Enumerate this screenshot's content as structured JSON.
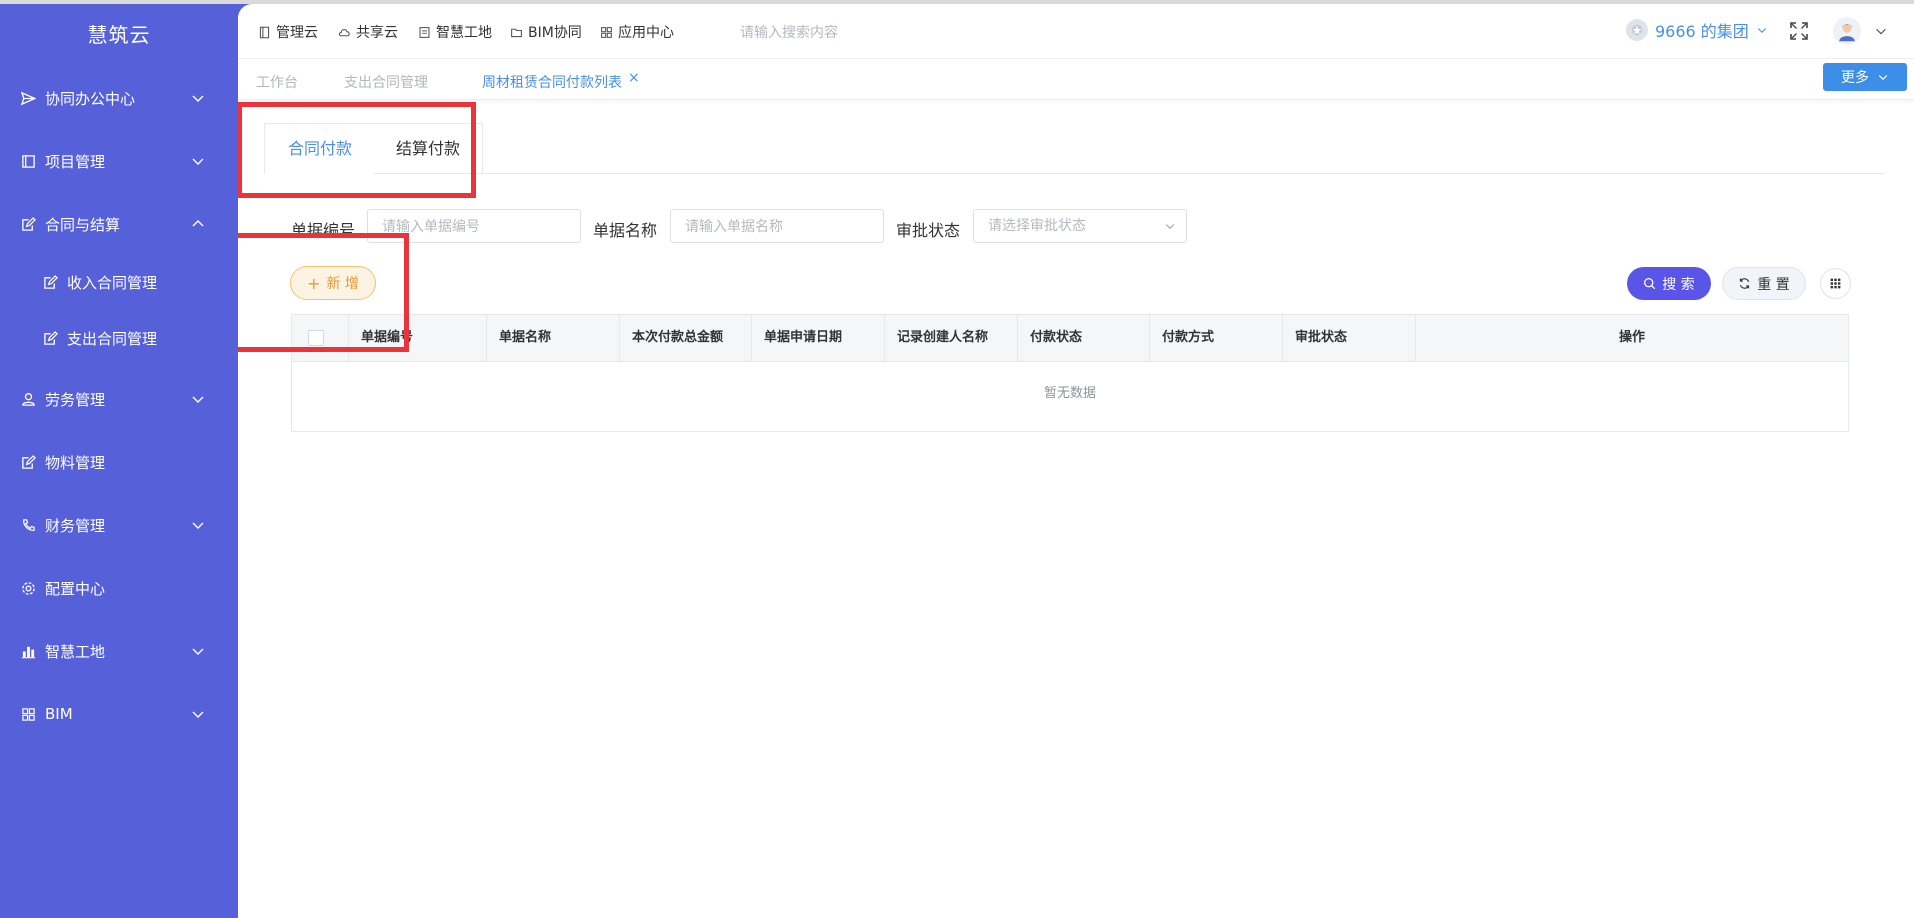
{
  "sidebar": {
    "brand": "慧筑云",
    "items": [
      {
        "label": "协同办公中心",
        "icon": "send-icon",
        "chevron": "down"
      },
      {
        "label": "项目管理",
        "icon": "book-icon",
        "chevron": "down"
      },
      {
        "label": "合同与结算",
        "icon": "edit-icon",
        "chevron": "up"
      },
      {
        "label": "收入合同管理",
        "icon": "edit-icon",
        "chevron": ""
      },
      {
        "label": "支出合同管理",
        "icon": "edit-icon",
        "chevron": ""
      },
      {
        "label": "劳务管理",
        "icon": "worker-icon",
        "chevron": "down"
      },
      {
        "label": "物料管理",
        "icon": "edit-icon",
        "chevron": ""
      },
      {
        "label": "财务管理",
        "icon": "phone-icon",
        "chevron": "down"
      },
      {
        "label": "配置中心",
        "icon": "gear-icon",
        "chevron": ""
      },
      {
        "label": "智慧工地",
        "icon": "bar-chart-icon",
        "chevron": "down"
      },
      {
        "label": "BIM",
        "icon": "grid-icon",
        "chevron": "down"
      }
    ]
  },
  "header": {
    "nav": [
      {
        "label": "管理云",
        "icon": "doc-icon"
      },
      {
        "label": "共享云",
        "icon": "cloud-icon"
      },
      {
        "label": "智慧工地",
        "icon": "page-icon"
      },
      {
        "label": "BIM协同",
        "icon": "folder-icon"
      },
      {
        "label": "应用中心",
        "icon": "apps-icon"
      }
    ],
    "search_placeholder": "请输入搜索内容",
    "org_name": "9666 的集团"
  },
  "page_tabs": [
    {
      "label": "工作台",
      "active": false
    },
    {
      "label": "支出合同管理",
      "active": false
    },
    {
      "label": "周材租赁合同付款列表",
      "active": true
    }
  ],
  "more_label": "更多",
  "content_tabs": {
    "contract_pay": "合同付款",
    "settle_pay": "结算付款"
  },
  "filters": {
    "doc_no_label": "单据编号",
    "doc_no_placeholder": "请输入单据编号",
    "doc_name_label": "单据名称",
    "doc_name_placeholder": "请输入单据名称",
    "approval_label": "审批状态",
    "approval_placeholder": "请选择审批状态"
  },
  "buttons": {
    "add": "新 增",
    "search": "搜 索",
    "reset": "重 置"
  },
  "table": {
    "columns": [
      "单据编号",
      "单据名称",
      "本次付款总金额",
      "单据申请日期",
      "记录创建人名称",
      "付款状态",
      "付款方式",
      "审批状态",
      "操作"
    ],
    "empty_text": "暂无数据"
  },
  "colors": {
    "sidebar": "#5661d9",
    "accent": "#4a90e2",
    "highlight": "#e8343a",
    "search_button": "#5a55e8"
  }
}
